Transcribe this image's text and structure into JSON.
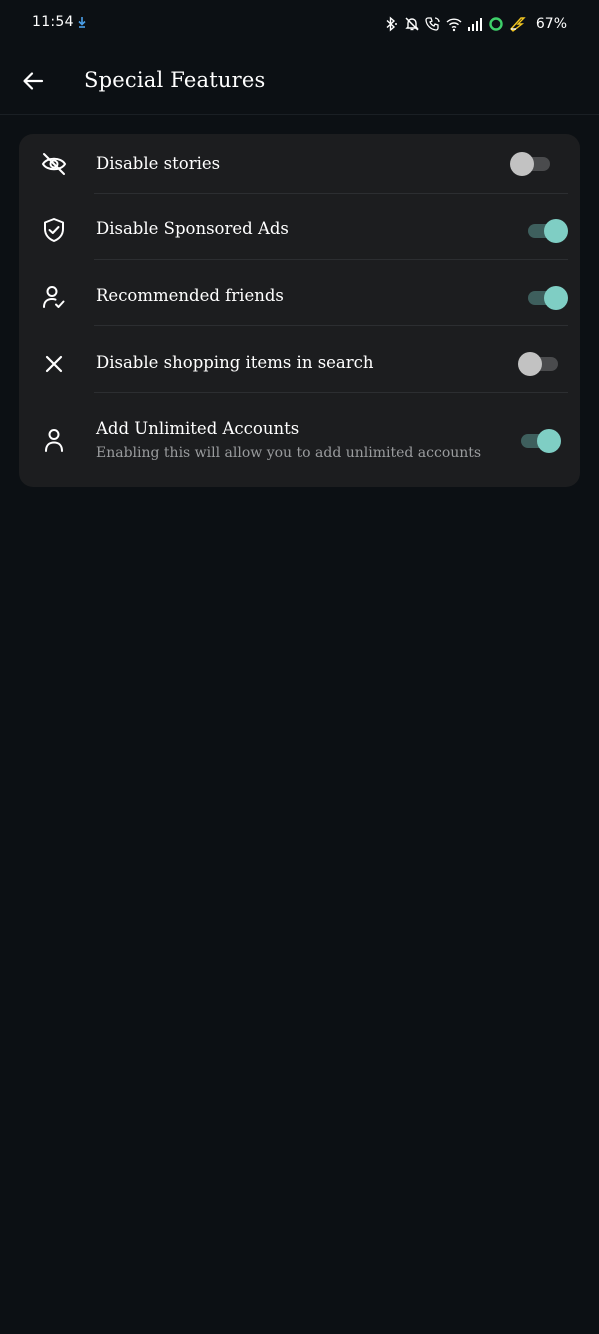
{
  "status_bar": {
    "time": "11:54",
    "battery": "67%"
  },
  "app_bar": {
    "title": "Special Features"
  },
  "settings": [
    {
      "label": "Disable stories",
      "subtitle": "",
      "icon": "eye-off-icon",
      "enabled": false
    },
    {
      "label": "Disable Sponsored Ads",
      "subtitle": "",
      "icon": "shield-check-icon",
      "enabled": true
    },
    {
      "label": "Recommended friends",
      "subtitle": "",
      "icon": "user-check-icon",
      "enabled": true
    },
    {
      "label": "Disable shopping items in search",
      "subtitle": "",
      "icon": "close-icon",
      "enabled": false
    },
    {
      "label": "Add Unlimited Accounts",
      "subtitle": "Enabling this will allow you to add unlimited accounts",
      "icon": "user-icon",
      "enabled": true
    }
  ],
  "colors": {
    "background": "#0c1014",
    "card": "#1c1d1f",
    "toggle_on_thumb": "#7fcec4",
    "toggle_on_track": "#3e5f5d",
    "toggle_off_thumb": "#c2c2c2",
    "toggle_off_track": "#4a4b4d"
  }
}
